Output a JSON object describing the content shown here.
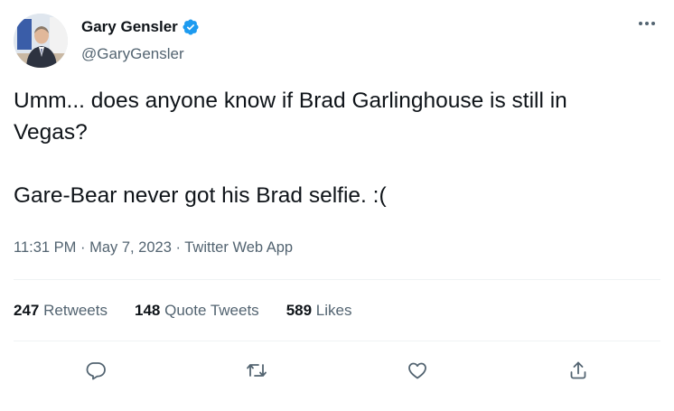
{
  "author": {
    "name": "Gary Gensler",
    "handle": "@GaryGensler",
    "verified": true,
    "avatar_icon": "profile-photo"
  },
  "tweet": {
    "line1": "Umm... does anyone know if Brad Garlinghouse is still in",
    "line2": "Vegas?",
    "line3": "Gare-Bear never got his Brad selfie. :("
  },
  "meta": {
    "time": "11:31 PM",
    "separator": " · ",
    "date": "May 7, 2023",
    "source": "Twitter Web App"
  },
  "stats": {
    "retweets_count": "247",
    "retweets_label": "Retweets",
    "quotes_count": "148",
    "quotes_label": "Quote Tweets",
    "likes_count": "589",
    "likes_label": "Likes"
  },
  "actions": {
    "reply": "reply-icon",
    "retweet": "retweet-icon",
    "like": "heart-icon",
    "share": "share-icon"
  },
  "colors": {
    "text": "#0f1419",
    "secondary": "#536471",
    "verified": "#1d9bf0",
    "divider": "#eff3f4"
  }
}
